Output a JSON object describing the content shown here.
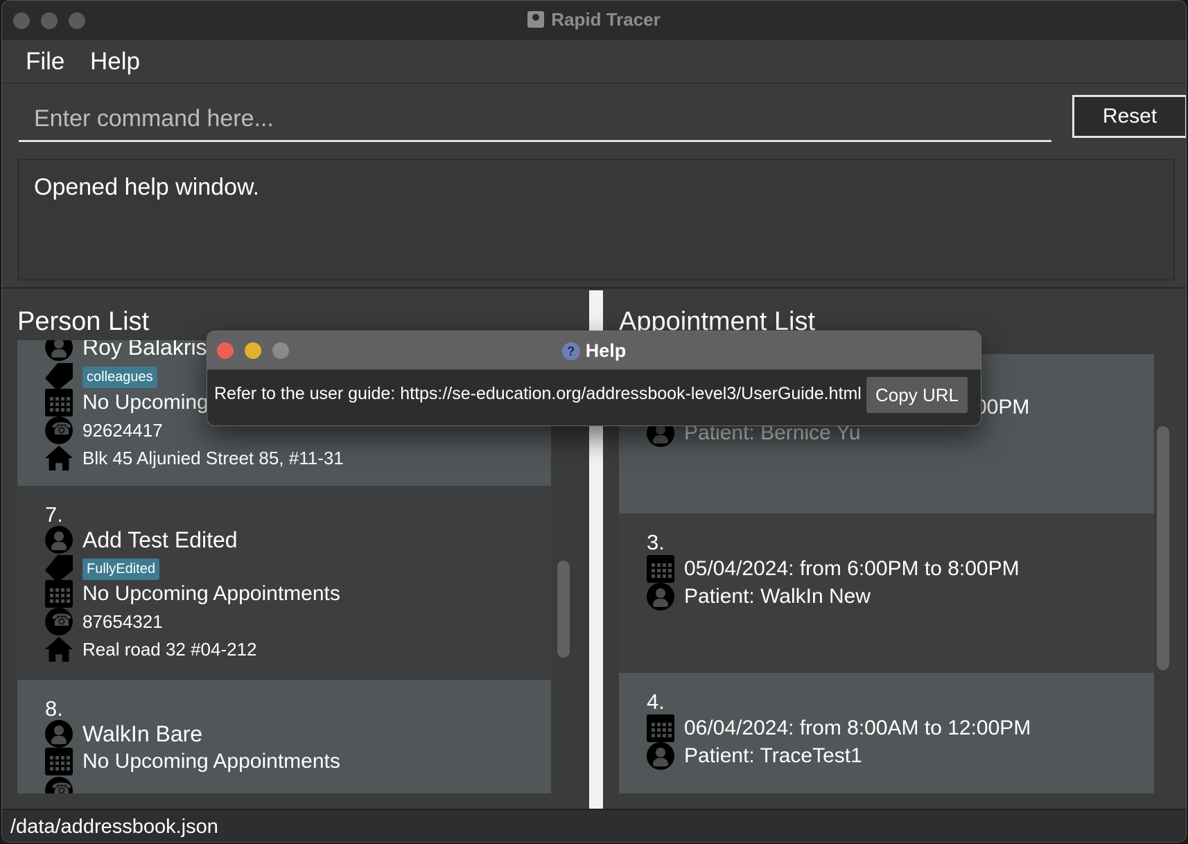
{
  "window": {
    "title": "Rapid Tracer"
  },
  "menu": {
    "file": "File",
    "help": "Help"
  },
  "command": {
    "placeholder": "Enter command here...",
    "reset_label": "Reset"
  },
  "result": {
    "message": "Opened help window."
  },
  "person_list": {
    "title": "Person List",
    "cards": [
      {
        "name": "Roy Balakrish",
        "tag": "colleagues",
        "appointment": "No Upcoming A",
        "phone": "92624417",
        "address": "Blk 45 Aljunied Street 85, #11-31"
      },
      {
        "index": "7.",
        "name": "Add Test Edited",
        "tag": "FullyEdited",
        "appointment": "No Upcoming Appointments",
        "phone": "87654321",
        "address": "Real road 32 #04-212"
      },
      {
        "index": "8.",
        "name": "WalkIn Bare",
        "appointment": "No Upcoming Appointments"
      }
    ]
  },
  "appointment_list": {
    "title": "Appointment List",
    "cards": [
      {
        "time_fragment": "00PM",
        "patient": "Patient: Bernice Yu"
      },
      {
        "index": "3.",
        "time": "05/04/2024: from 6:00PM to 8:00PM",
        "patient": "Patient: WalkIn New"
      },
      {
        "index": "4.",
        "time": "06/04/2024: from 8:00AM to 12:00PM",
        "patient": "Patient: TraceTest1"
      }
    ]
  },
  "status": {
    "path": "/data/addressbook.json"
  },
  "help_dialog": {
    "title": "Help",
    "message": "Refer to the user guide: https://se-education.org/addressbook-level3/UserGuide.html",
    "copy_label": "Copy URL"
  }
}
